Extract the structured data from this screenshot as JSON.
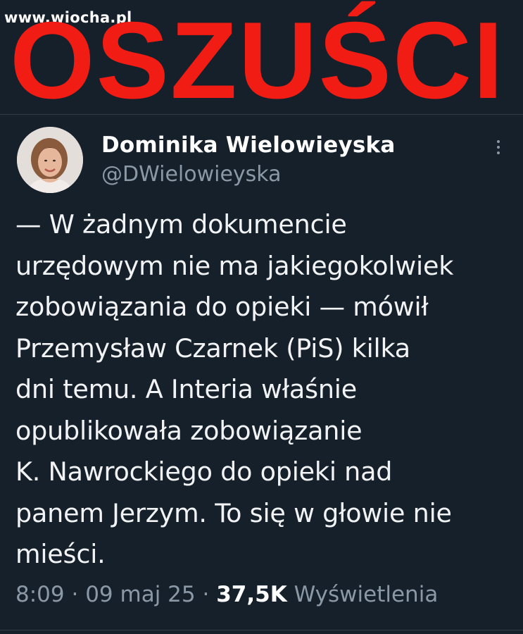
{
  "watermark": "www.wiocha.pl",
  "banner": "OSZUŚCI",
  "tweet": {
    "author_name": "Dominika Wielowieyska",
    "author_handle": "@DWielowieyska",
    "text_lines": [
      "— W żadnym dokumencie",
      "urzędowym nie ma jakiegokolwiek",
      "zobowiązania do opieki — mówił",
      "Przemysław Czarnek (PiS) kilka",
      "dni temu. A Interia właśnie",
      "opublikowała zobowiązanie",
      "K. Nawrockiego do opieki nad",
      "panem Jerzym. To się w głowie nie",
      "mieści."
    ],
    "time": "8:09",
    "date": "09 maj 25",
    "separator": "·",
    "views_count": "37,5K",
    "views_label": "Wyświetlenia"
  },
  "icons": {
    "avatar": "author-avatar",
    "more": "more-options-icon"
  },
  "colors": {
    "background": "#15202b",
    "banner": "#f11d14",
    "secondary_text": "#8b98a5"
  }
}
